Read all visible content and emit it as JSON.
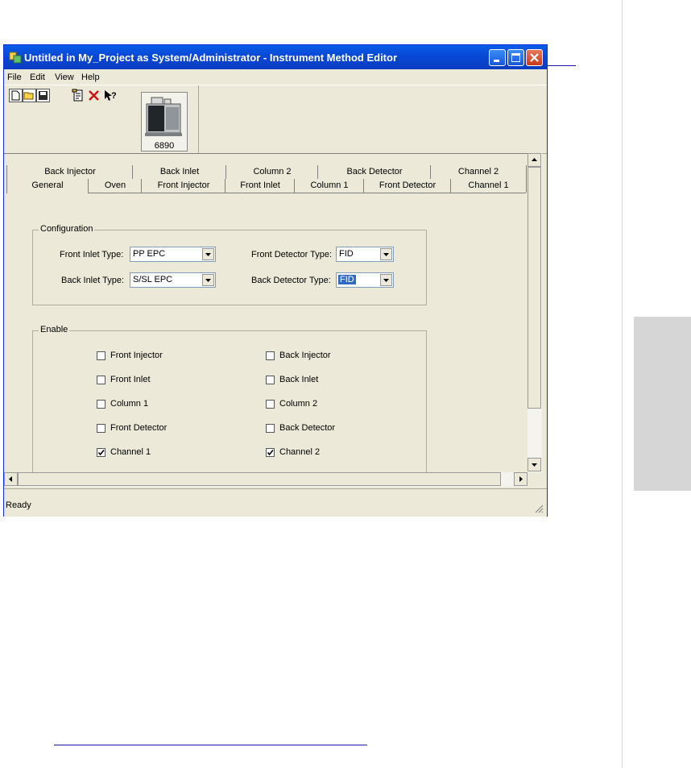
{
  "window": {
    "title": "Untitled in My_Project as System/Administrator - Instrument Method Editor"
  },
  "menu": [
    "File",
    "Edit",
    "View",
    "Help"
  ],
  "instrument": {
    "label": "6890"
  },
  "tabs": {
    "row_top": [
      "Back Injector",
      "Back Inlet",
      "Column 2",
      "Back Detector",
      "Channel 2"
    ],
    "row_bottom": [
      "General",
      "Oven",
      "Front Injector",
      "Front Inlet",
      "Column 1",
      "Front Detector",
      "Channel 1"
    ],
    "active": "General"
  },
  "configuration": {
    "title": "Configuration",
    "front_inlet_label": "Front Inlet Type:",
    "front_inlet_value": "PP EPC",
    "back_inlet_label": "Back Inlet Type:",
    "back_inlet_value": "S/SL EPC",
    "front_detector_label": "Front Detector Type:",
    "front_detector_value": "FID",
    "back_detector_label": "Back Detector Type:",
    "back_detector_value": "FID"
  },
  "enable": {
    "title": "Enable",
    "items": [
      {
        "label": "Front Injector",
        "checked": false
      },
      {
        "label": "Back Injector",
        "checked": false
      },
      {
        "label": "Front Inlet",
        "checked": false
      },
      {
        "label": "Back Inlet",
        "checked": false
      },
      {
        "label": "Column 1",
        "checked": false
      },
      {
        "label": "Column 2",
        "checked": false
      },
      {
        "label": "Front Detector",
        "checked": false
      },
      {
        "label": "Back Detector",
        "checked": false
      },
      {
        "label": "Channel 1",
        "checked": true
      },
      {
        "label": "Channel 2",
        "checked": true
      }
    ]
  },
  "status": {
    "text": "Ready"
  },
  "icons": {
    "title": "app-icon",
    "minimize": "minimize-icon",
    "maximize": "maximize-icon",
    "close": "close-icon",
    "toolbar": [
      "new-icon",
      "open-icon",
      "save-icon",
      "properties-icon",
      "delete-icon",
      "help-icon"
    ]
  }
}
